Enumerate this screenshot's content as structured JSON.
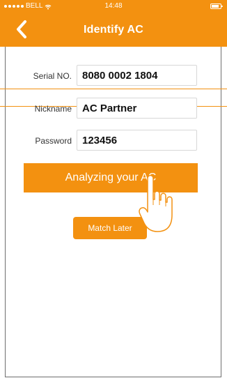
{
  "status_bar": {
    "carrier": "BELL",
    "time": "14:48",
    "icons": [
      "signal-dots-icon",
      "wifi-icon",
      "battery-icon"
    ]
  },
  "header": {
    "title": "Identify AC",
    "back_icon": "chevron-left-icon"
  },
  "form": {
    "serial_label": "Serial NO.",
    "serial_value": "8080 0002 1804",
    "nickname_label": "Nickname",
    "nickname_value": "AC Partner",
    "password_label": "Password",
    "password_value": "123456"
  },
  "actions": {
    "analyze_label": "Analyzing your AC",
    "match_later_label": "Match Later"
  },
  "overlay": {
    "hand_icon": "tap-hand-icon"
  },
  "colors": {
    "accent": "#f39110",
    "text": "#333333",
    "border": "#d7d7d7"
  }
}
